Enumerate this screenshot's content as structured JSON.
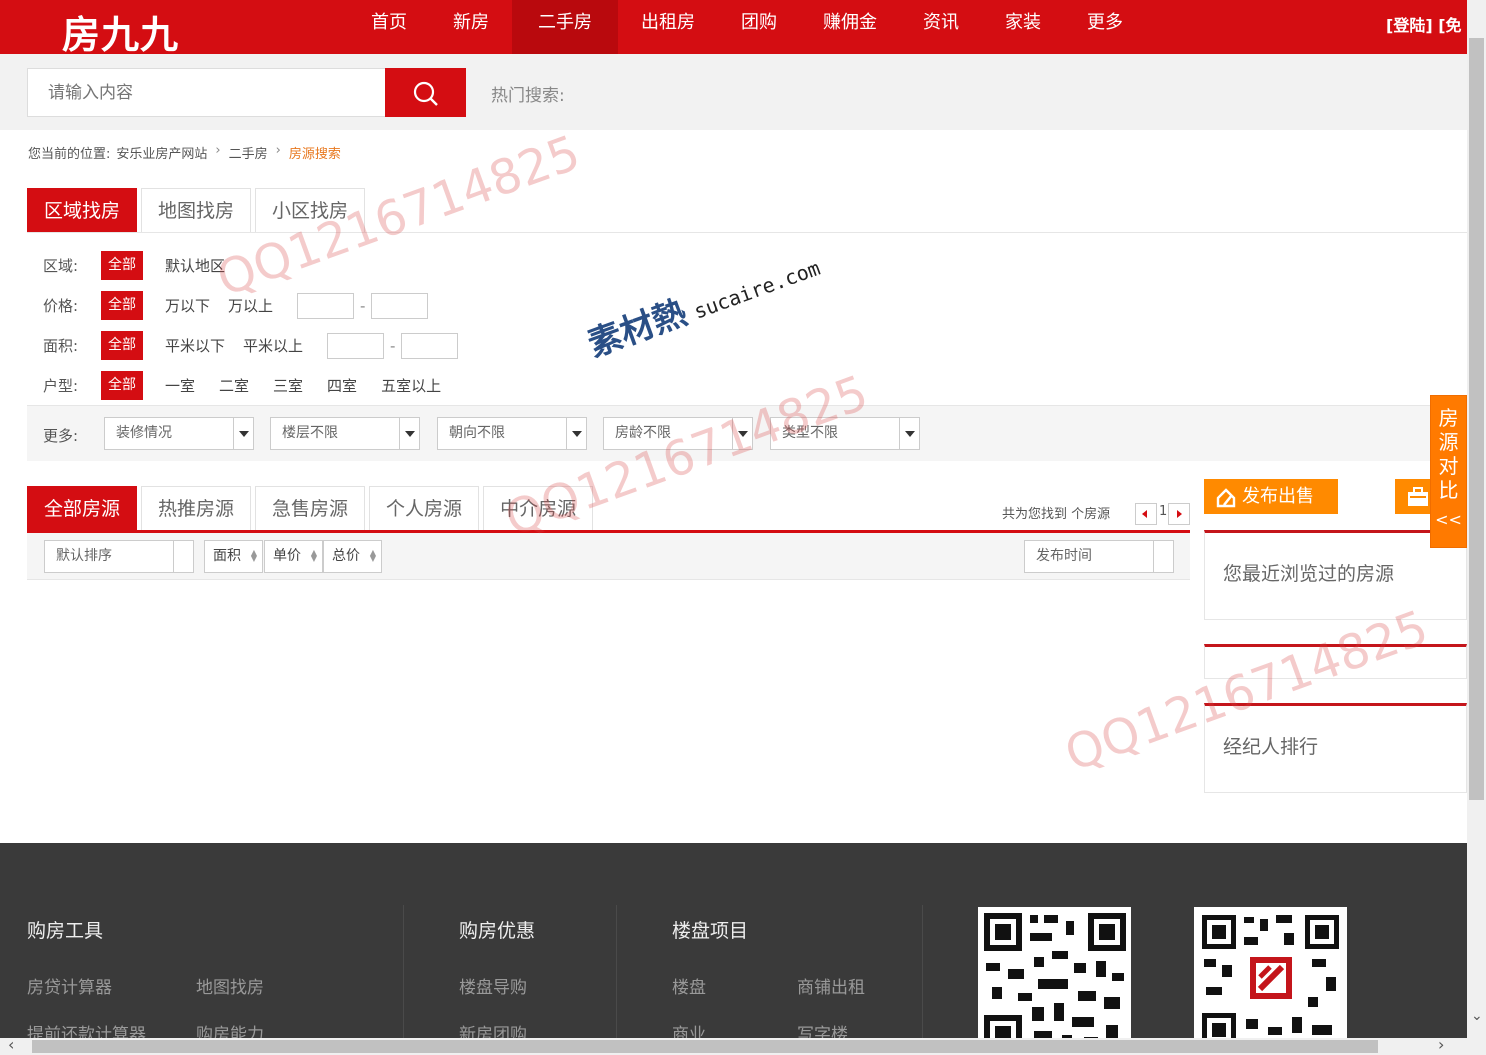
{
  "header": {
    "logo": "房九九",
    "nav": [
      "首页",
      "新房",
      "二手房",
      "出租房",
      "团购",
      "赚佣金",
      "资讯",
      "家装",
      "更多"
    ],
    "active_nav": 2,
    "login": "[登陆]",
    "register": "[免"
  },
  "search": {
    "placeholder": "请输入内容",
    "hot_label": "热门搜索:"
  },
  "breadcrumb": {
    "prefix": "您当前的位置:",
    "items": [
      "安乐业房产网站",
      "二手房"
    ],
    "current": "房源搜索"
  },
  "find_tabs": [
    "区域找房",
    "地图找房",
    "小区找房"
  ],
  "filters": {
    "area_label": "区域:",
    "area_all": "全部",
    "area_opts": [
      "默认地区"
    ],
    "price_label": "价格:",
    "price_all": "全部",
    "price_opts": [
      "万以下",
      "万以上"
    ],
    "size_label": "面积:",
    "size_all": "全部",
    "size_opts": [
      "平米以下",
      "平米以上"
    ],
    "room_label": "户型:",
    "room_all": "全部",
    "room_opts": [
      "一室",
      "二室",
      "三室",
      "四室",
      "五室以上"
    ],
    "range_dash": "-",
    "more_label": "更多:",
    "more_selects": [
      "装修情况",
      "楼层不限",
      "朝向不限",
      "房龄不限",
      "类型不限"
    ]
  },
  "list_tabs": [
    "全部房源",
    "热推房源",
    "急售房源",
    "个人房源",
    "中介房源"
  ],
  "result": {
    "count_text": "共为您找到 个房源",
    "page": "1"
  },
  "sort": {
    "default": "默认排序",
    "buttons": [
      "面积",
      "单价",
      "总价"
    ],
    "time": "发布时间"
  },
  "sidebar": {
    "publish": "发布出售",
    "recent": "您最近浏览过的房源",
    "agent": "经纪人排行",
    "compare": [
      "房",
      "源",
      "对",
      "比"
    ],
    "compare_chev": "<<"
  },
  "footer": {
    "col1": {
      "title": "购房工具",
      "links": [
        "房贷计算器",
        "地图找房",
        "提前还款计算器",
        "购房能力"
      ]
    },
    "col2": {
      "title": "购房优惠",
      "links": [
        "楼盘导购",
        "新房团购"
      ]
    },
    "col3": {
      "title": "楼盘项目",
      "links": [
        "楼盘",
        "商铺出租",
        "商业",
        "写字楼"
      ]
    }
  },
  "watermark": {
    "qq": "QQ1216714825",
    "brand": "素材熱",
    "site": "sucaire.com"
  },
  "colors": {
    "brand_red": "#d40d12",
    "orange": "#ff8a00",
    "footer_bg": "#3a3a3a"
  }
}
